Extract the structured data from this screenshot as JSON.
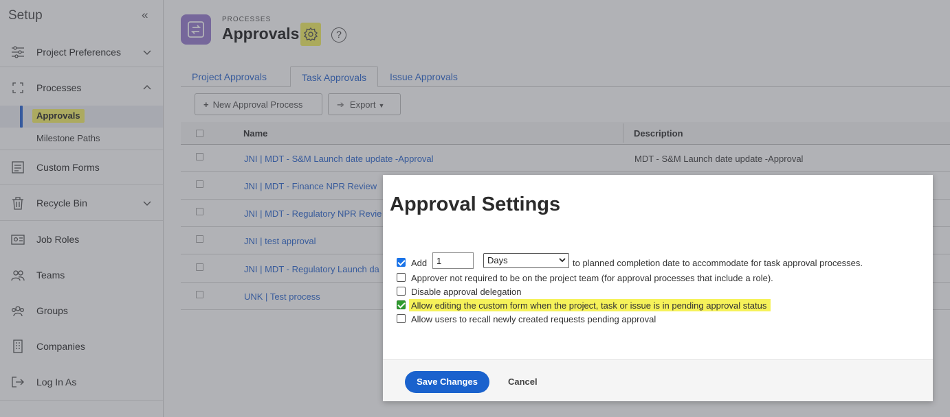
{
  "sidebar": {
    "title": "Setup",
    "collapse_glyph": "«",
    "items": [
      {
        "label": "Project Preferences",
        "icon": "sliders-icon",
        "expandable": true,
        "expanded": false
      },
      {
        "label": "Processes",
        "icon": "processes-icon",
        "expandable": true,
        "expanded": true
      },
      {
        "label": "Custom Forms",
        "icon": "form-icon",
        "expandable": false
      },
      {
        "label": "Recycle Bin",
        "icon": "trash-icon",
        "expandable": true,
        "expanded": false
      },
      {
        "label": "Job Roles",
        "icon": "id-card-icon",
        "expandable": false
      },
      {
        "label": "Teams",
        "icon": "team-icon",
        "expandable": false
      },
      {
        "label": "Groups",
        "icon": "groups-icon",
        "expandable": false
      },
      {
        "label": "Companies",
        "icon": "building-icon",
        "expandable": false
      },
      {
        "label": "Log In As",
        "icon": "login-icon",
        "expandable": false
      }
    ],
    "sub_items": [
      {
        "label": "Approvals",
        "active": true
      },
      {
        "label": "Milestone Paths",
        "active": false
      }
    ]
  },
  "header": {
    "eyebrow": "PROCESSES",
    "title": "Approvals",
    "help_glyph": "?"
  },
  "tabs": [
    {
      "label": "Project Approvals",
      "active": false
    },
    {
      "label": "Task Approvals",
      "active": true
    },
    {
      "label": "Issue Approvals",
      "active": false
    }
  ],
  "toolbar": {
    "new_label": "New Approval Process",
    "export_label": "Export"
  },
  "table": {
    "columns": [
      "Name",
      "Description"
    ],
    "rows": [
      {
        "name": "JNI | MDT - S&M Launch date update -Approval",
        "description": "MDT - S&M Launch date update -Approval"
      },
      {
        "name": "JNI | MDT - Finance NPR Review",
        "description": ""
      },
      {
        "name": "JNI | MDT - Regulatory NPR Revie",
        "description": ""
      },
      {
        "name": "JNI | test approval",
        "description": ""
      },
      {
        "name": "JNI | MDT - Regulatory Launch da",
        "description": ""
      },
      {
        "name": "UNK | Test process",
        "description": ""
      }
    ]
  },
  "modal": {
    "title": "Approval Settings",
    "add_label": "Add",
    "add_value": "1",
    "unit_value": "Days",
    "add_suffix": "to planned completion date to accommodate for task approval processes.",
    "options": [
      {
        "label": "Approver not required to be on the project team (for approval processes that include a role).",
        "checked": false
      },
      {
        "label": "Disable approval delegation",
        "checked": false
      },
      {
        "label": "Allow editing the custom form when the project, task or issue is in pending approval status",
        "checked": true,
        "highlighted": true
      },
      {
        "label": "Allow users to recall newly created requests pending approval",
        "checked": false
      }
    ],
    "add_checked": true,
    "save_label": "Save Changes",
    "cancel_label": "Cancel"
  },
  "colors": {
    "accent": "#1a62cd",
    "link": "#2f6ad0",
    "highlight": "#f6f25a",
    "app_icon": "#9a7ed1"
  }
}
